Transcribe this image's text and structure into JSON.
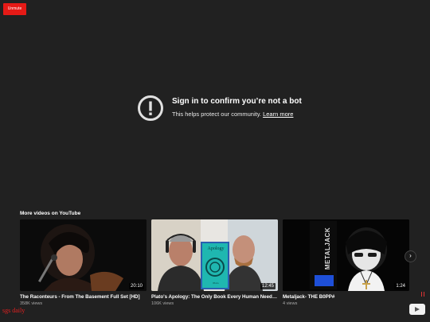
{
  "unmute": {
    "label": "Unmute"
  },
  "notice": {
    "title": "Sign in to confirm you’re not a bot",
    "subtitle": "This helps protect our community.",
    "link": "Learn more"
  },
  "more": {
    "heading": "More videos on YouTube",
    "videos": [
      {
        "title": "The Raconteurs - From The Basement Full Set [HD]",
        "views": "358K views",
        "duration": "20:10"
      },
      {
        "title": "Plato's Apology: The Only Book Every Human Needs to Read",
        "views": "106K views",
        "duration": "12:45",
        "book_title": "Apology",
        "book_author": "Plato"
      },
      {
        "title": "Metaljack- THE B0PP#",
        "views": "4 views",
        "duration": "1:24",
        "banner_text": "METALJACK"
      }
    ]
  },
  "watermark": "sgs daily",
  "colors": {
    "background": "#212121",
    "unmute": "#e51a16",
    "watermark": "#e02020"
  }
}
